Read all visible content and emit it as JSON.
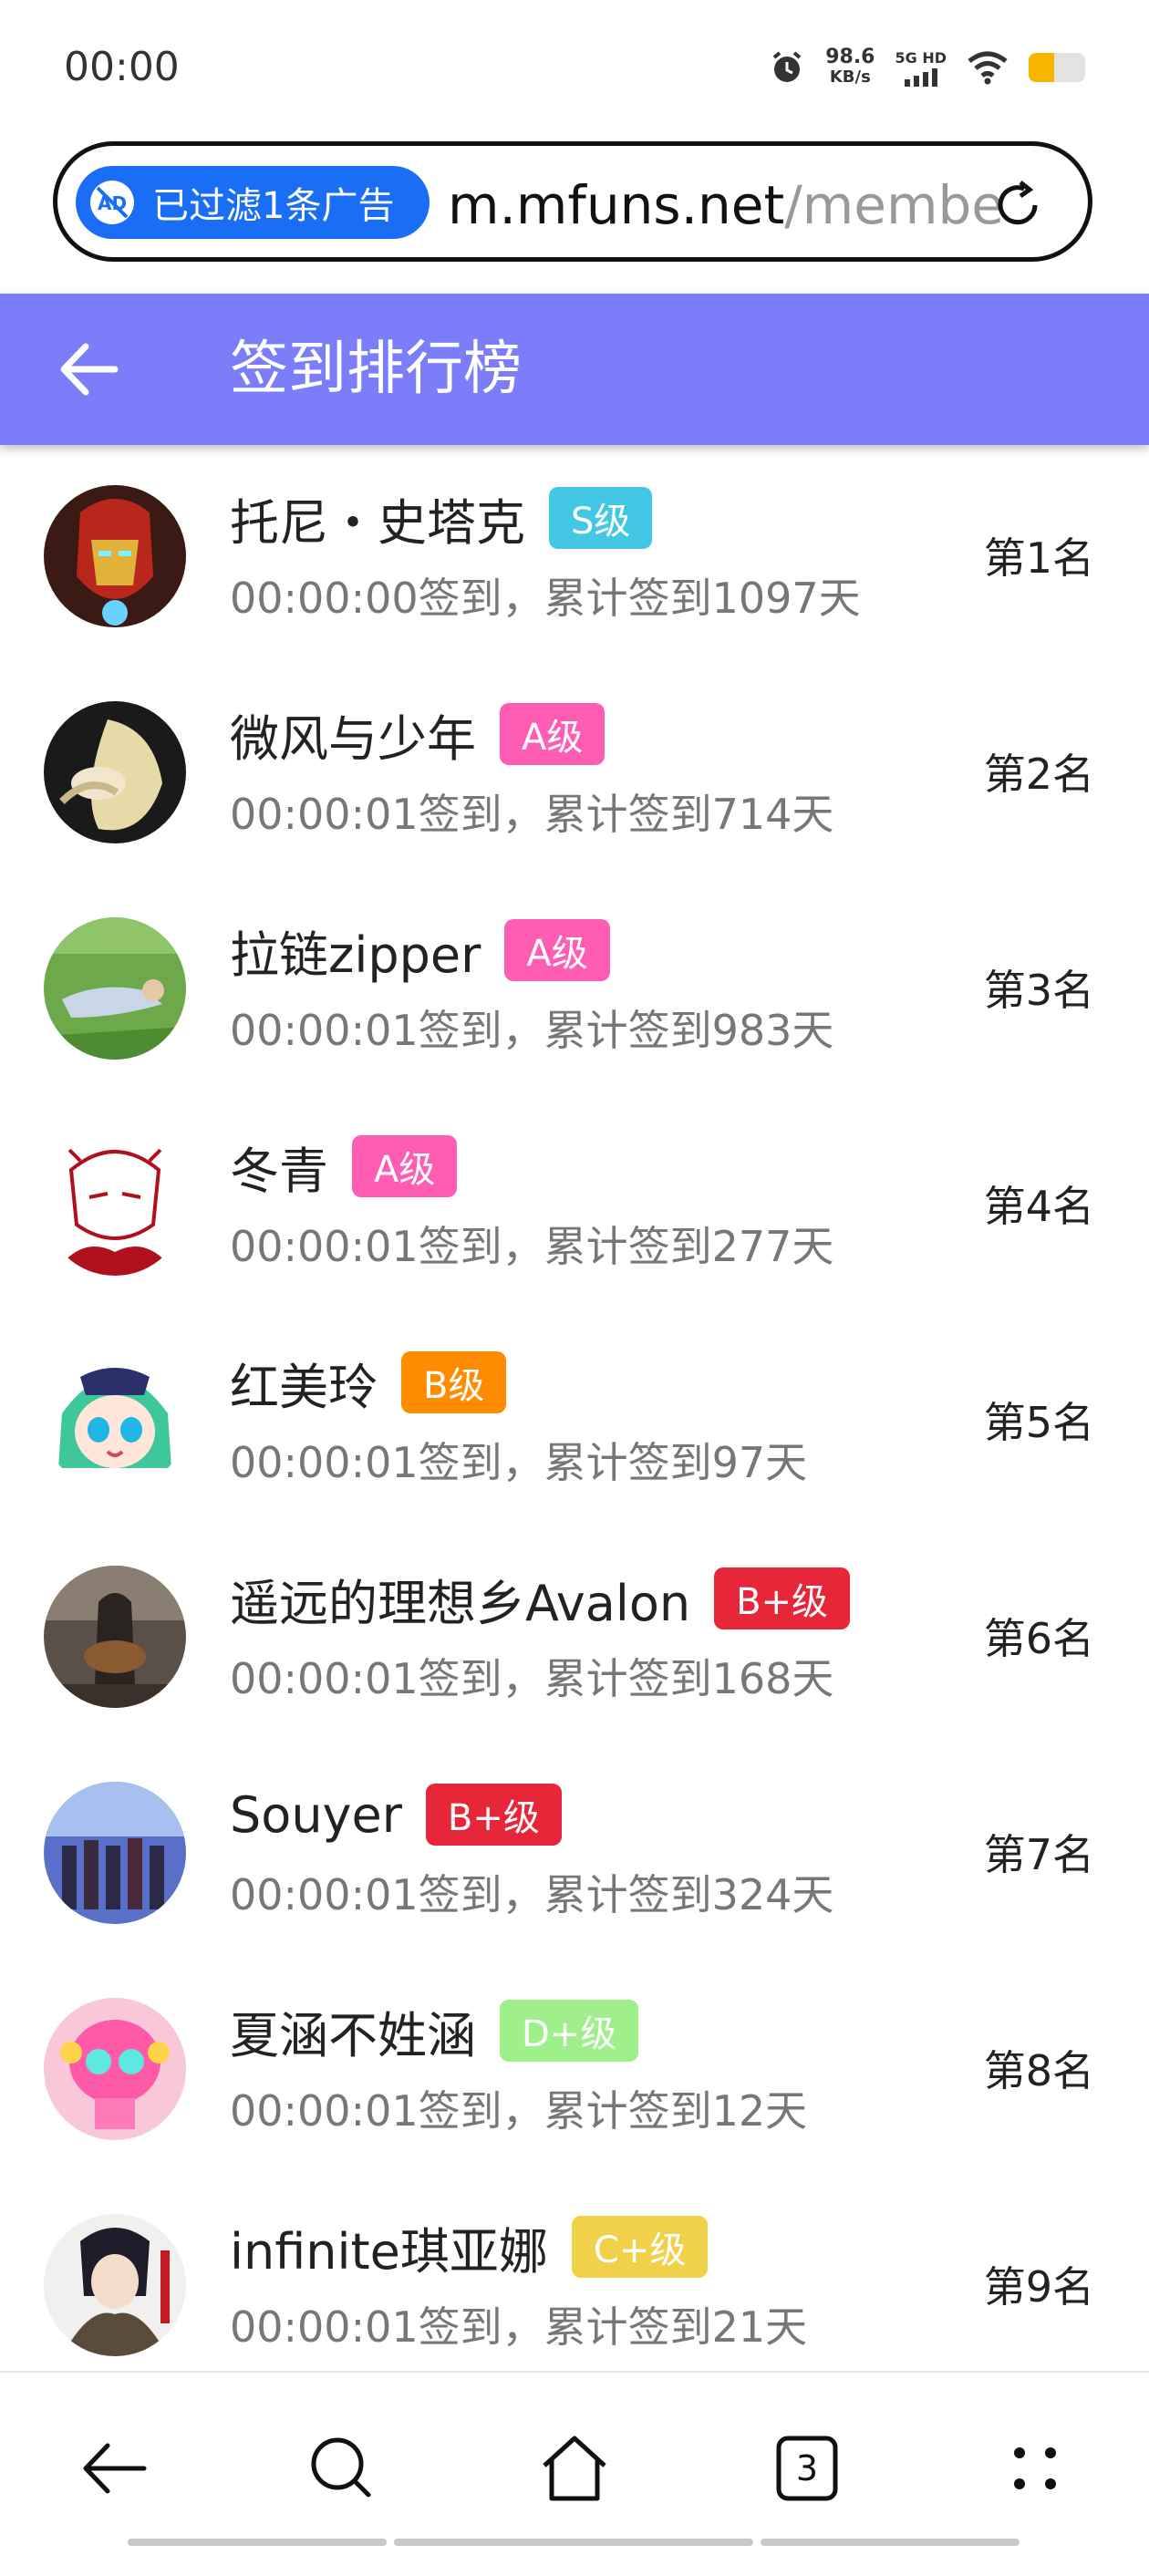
{
  "status_bar": {
    "time": "00:00",
    "speed_value": "98.6",
    "speed_unit": "KB/s",
    "network": "5G HD",
    "battery_level": 0.45,
    "battery_color": "#f7b500"
  },
  "browser": {
    "ad_filter_label": "已过滤1条广告",
    "url_host": "m.mfuns.net",
    "url_rest": "/membe"
  },
  "header": {
    "title": "签到排行榜",
    "color": "#7b7ef8"
  },
  "rankings": [
    {
      "name": "托尼・史塔克",
      "level": "S级",
      "level_color": "#42c7e4",
      "info": "00:00:00签到，累计签到1097天",
      "rank": "第1名"
    },
    {
      "name": "微风与少年",
      "level": "A级",
      "level_color": "#ff5cb4",
      "info": "00:00:01签到，累计签到714天",
      "rank": "第2名"
    },
    {
      "name": "拉链zipper",
      "level": "A级",
      "level_color": "#ff5cb4",
      "info": "00:00:01签到，累计签到983天",
      "rank": "第3名"
    },
    {
      "name": "冬青",
      "level": "A级",
      "level_color": "#ff5cb4",
      "info": "00:00:01签到，累计签到277天",
      "rank": "第4名"
    },
    {
      "name": "红美玲",
      "level": "B级",
      "level_color": "#ff8c00",
      "info": "00:00:01签到，累计签到97天",
      "rank": "第5名"
    },
    {
      "name": "遥远的理想乡Avalon",
      "level": "B+级",
      "level_color": "#e8263a",
      "info": "00:00:01签到，累计签到168天",
      "rank": "第6名"
    },
    {
      "name": "Souyer",
      "level": "B+级",
      "level_color": "#e8263a",
      "info": "00:00:01签到，累计签到324天",
      "rank": "第7名"
    },
    {
      "name": "夏涵不姓涵",
      "level": "D+级",
      "level_color": "#9ff08a",
      "info": "00:00:01签到，累计签到12天",
      "rank": "第8名"
    },
    {
      "name": "infinite琪亚娜",
      "level": "C+级",
      "level_color": "#f2d14a",
      "info": "00:00:01签到，累计签到21天",
      "rank": "第9名"
    }
  ],
  "bottom_nav": {
    "tab_count": "3"
  }
}
